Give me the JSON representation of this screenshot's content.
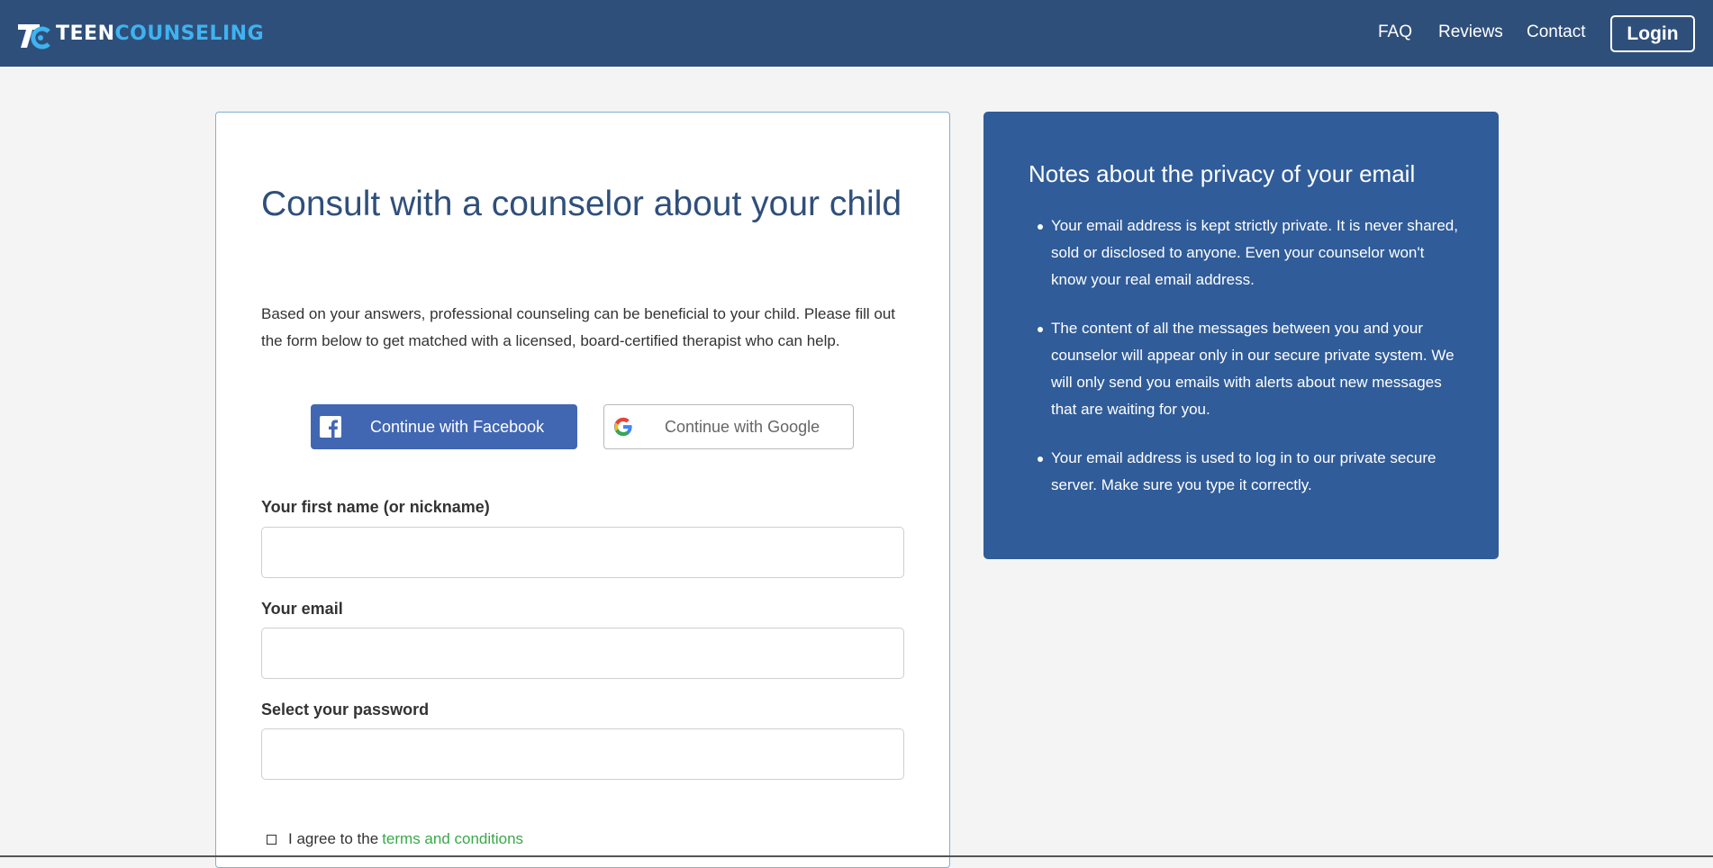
{
  "header": {
    "logo": {
      "teen": "TEEN",
      "counseling": "COUNSELING"
    },
    "nav": [
      {
        "label": "FAQ"
      },
      {
        "label": "Reviews"
      },
      {
        "label": "Contact"
      }
    ],
    "login_label": "Login"
  },
  "form": {
    "headline": "Consult with a counselor about your child",
    "intro": "Based on your answers, professional counseling can be beneficial to your child. Please fill out the form below to get matched with a licensed, board-certified therapist who can help.",
    "social": {
      "facebook_label": "Continue with Facebook",
      "google_label": "Continue with Google"
    },
    "fields": [
      {
        "label": "Your first name (or nickname)",
        "value": ""
      },
      {
        "label": "Your email",
        "value": ""
      },
      {
        "label": "Select your password",
        "value": ""
      }
    ],
    "agree": {
      "text": "I agree to the",
      "link": "terms and conditions",
      "checked": false
    }
  },
  "privacy": {
    "title": "Notes about the privacy of your email",
    "notes": [
      "Your email address is kept strictly private. It is never shared, sold or disclosed to anyone. Even your counselor won't know your real email address.",
      "The content of all the messages between you and your counselor will appear only in our secure private system. We will only send you emails with alerts about new messages that are waiting for you.",
      "Your email address is used to log in to our private secure server. Make sure you type it correctly."
    ]
  },
  "colors": {
    "header_bg": "#2f4f7b",
    "accent_blue": "#3fb3f0",
    "facebook": "#4267b2",
    "privacy_bg": "#305c99",
    "link_green": "#3aa84a"
  },
  "icons": [
    "logo-mark-icon",
    "facebook-icon",
    "google-icon",
    "checkbox-icon"
  ]
}
